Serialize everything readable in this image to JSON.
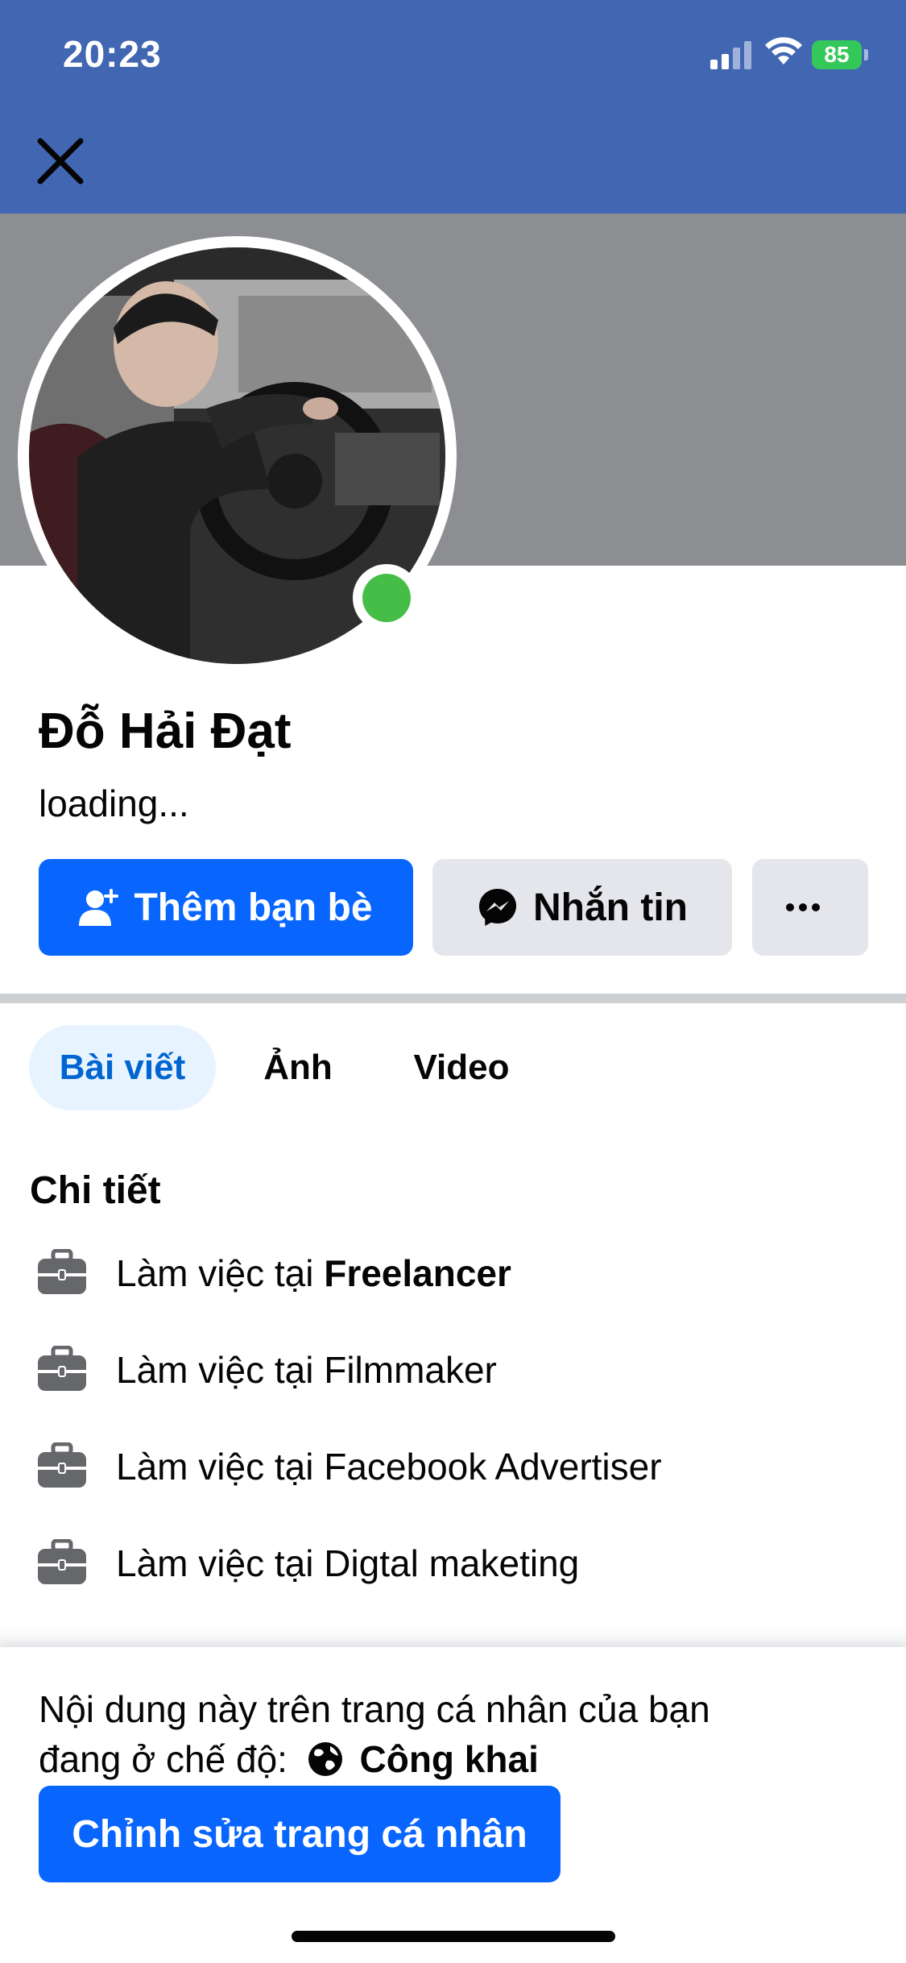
{
  "status_bar": {
    "time": "20:23",
    "battery": "85"
  },
  "profile": {
    "name": "Đỗ Hải Đạt",
    "subtitle": "loading...",
    "online": true
  },
  "actions": {
    "add_friend": "Thêm bạn bè",
    "message": "Nhắn tin",
    "more": "···"
  },
  "tabs": [
    {
      "label": "Bài viết",
      "active": true
    },
    {
      "label": "Ảnh",
      "active": false
    },
    {
      "label": "Video",
      "active": false
    }
  ],
  "details": {
    "title": "Chi tiết",
    "items": [
      {
        "prefix": "Làm việc tại ",
        "bold": "Freelancer",
        "rest": ""
      },
      {
        "prefix": "Làm việc tại ",
        "bold": "",
        "rest": "Filmmaker"
      },
      {
        "prefix": "Làm việc tại ",
        "bold": "",
        "rest": "Facebook Advertiser"
      },
      {
        "prefix": "Làm việc tại ",
        "bold": "",
        "rest": "Digtal maketing"
      }
    ]
  },
  "bottom_sheet": {
    "notice_line1": "Nội dung này trên trang cá nhân của bạn",
    "notice_line2": "đang ở chế độ:",
    "visibility": "Công khai",
    "edit_button": "Chỉnh sửa trang cá nhân"
  },
  "colors": {
    "status_bar_bg": "#4267b2",
    "primary": "#0866ff",
    "online": "#45bd47",
    "cover": "#8c8e92"
  }
}
